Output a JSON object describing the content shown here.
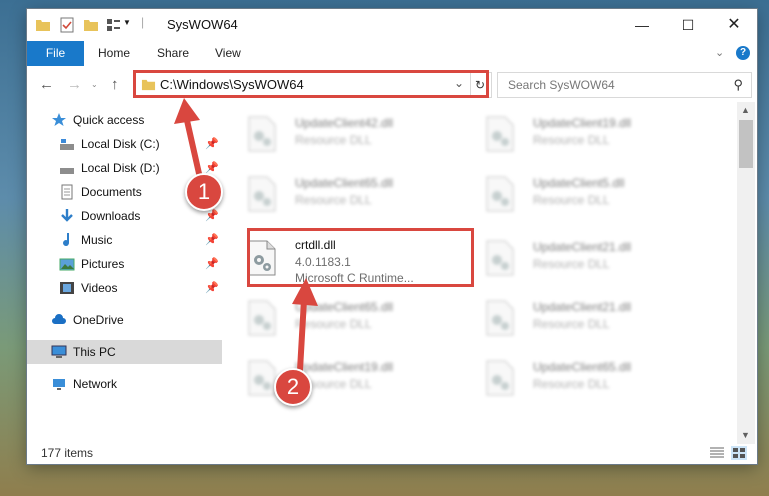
{
  "window": {
    "title": "SysWOW64"
  },
  "ribbon": {
    "file": "File",
    "tabs": [
      "Home",
      "Share",
      "View"
    ]
  },
  "address": {
    "path": "C:\\Windows\\SysWOW64"
  },
  "search": {
    "placeholder": "Search SysWOW64"
  },
  "sidebar": {
    "items": [
      {
        "label": "Quick access",
        "icon": "star-icon",
        "pinned": false
      },
      {
        "label": "Local Disk (C:)",
        "icon": "drive-icon",
        "pinned": true
      },
      {
        "label": "Local Disk (D:)",
        "icon": "drive-icon",
        "pinned": true
      },
      {
        "label": "Documents",
        "icon": "documents-icon",
        "pinned": true
      },
      {
        "label": "Downloads",
        "icon": "download-icon",
        "pinned": true
      },
      {
        "label": "Music",
        "icon": "music-icon",
        "pinned": true
      },
      {
        "label": "Pictures",
        "icon": "pictures-icon",
        "pinned": true
      },
      {
        "label": "Videos",
        "icon": "videos-icon",
        "pinned": true
      },
      {
        "label": "OneDrive",
        "icon": "cloud-icon",
        "pinned": false
      },
      {
        "label": "This PC",
        "icon": "computer-icon",
        "pinned": false
      },
      {
        "label": "Network",
        "icon": "network-icon",
        "pinned": false
      }
    ]
  },
  "files": [
    {
      "name": "UpdateClient42.dll",
      "desc": "Resource DLL",
      "blurred": true
    },
    {
      "name": "UpdateClient19.dll",
      "desc": "Resource DLL",
      "blurred": true
    },
    {
      "name": "UpdateClient65.dll",
      "desc": "Resource DLL",
      "blurred": true
    },
    {
      "name": "UpdateClient5.dll",
      "desc": "Resource DLL",
      "blurred": true
    },
    {
      "name": "crtdll.dll",
      "version": "4.0.1183.1",
      "desc": "Microsoft C Runtime...",
      "blurred": false
    },
    {
      "name": "UpdateClient21.dll",
      "desc": "Resource DLL",
      "blurred": true
    },
    {
      "name": "UpdateClient65.dll",
      "desc": "Resource DLL",
      "blurred": true
    },
    {
      "name": "UpdateClient21.dll",
      "desc": "Resource DLL",
      "blurred": true
    },
    {
      "name": "UpdateClient19.dll",
      "desc": "Resource DLL",
      "blurred": true
    },
    {
      "name": "UpdateClient65.dll",
      "desc": "Resource DLL",
      "blurred": true
    }
  ],
  "status": {
    "items": "177 items"
  },
  "callouts": [
    "1",
    "2"
  ],
  "colors": {
    "accent": "#1979ca",
    "highlight": "#d9473f",
    "selected": "#d9d9d9"
  }
}
